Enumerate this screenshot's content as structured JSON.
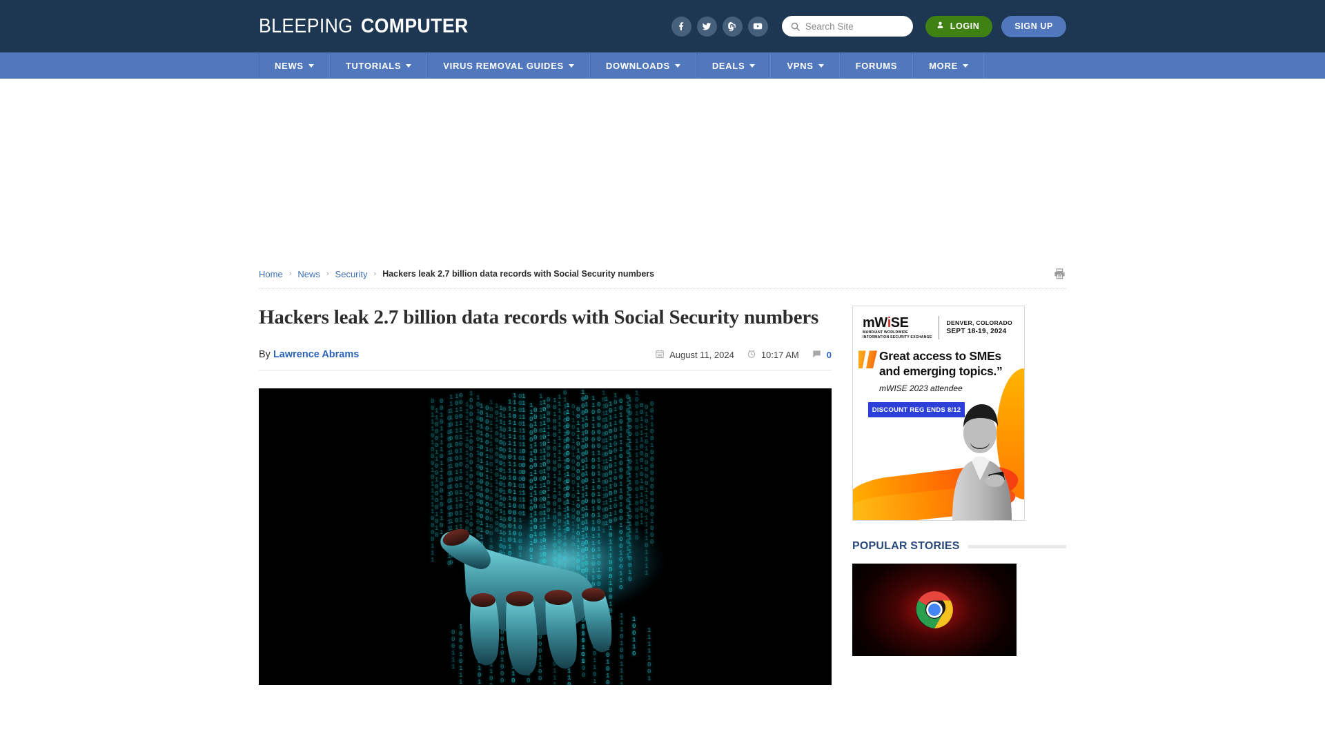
{
  "site": {
    "logo_thin": "BLEEPING",
    "logo_bold": "COMPUTER"
  },
  "header": {
    "social": [
      {
        "name": "facebook-icon",
        "label": "Facebook"
      },
      {
        "name": "twitter-icon",
        "label": "Twitter"
      },
      {
        "name": "mastodon-icon",
        "label": "Mastodon"
      },
      {
        "name": "youtube-icon",
        "label": "YouTube"
      }
    ],
    "search": {
      "placeholder": "Search Site",
      "value": ""
    },
    "login_label": "LOGIN",
    "signup_label": "SIGN UP",
    "colors": {
      "header_bg": "#1d3651",
      "nav_bg": "#5178bd",
      "login_green": "#3f8213",
      "signup_blue": "#5178bd"
    }
  },
  "nav": {
    "items": [
      {
        "label": "NEWS",
        "has_dropdown": true
      },
      {
        "label": "TUTORIALS",
        "has_dropdown": true
      },
      {
        "label": "VIRUS REMOVAL GUIDES",
        "has_dropdown": true
      },
      {
        "label": "DOWNLOADS",
        "has_dropdown": true
      },
      {
        "label": "DEALS",
        "has_dropdown": true
      },
      {
        "label": "VPNS",
        "has_dropdown": true
      },
      {
        "label": "FORUMS",
        "has_dropdown": false
      },
      {
        "label": "MORE",
        "has_dropdown": true
      }
    ]
  },
  "breadcrumb": {
    "home": "Home",
    "news": "News",
    "security": "Security",
    "current": "Hackers leak 2.7 billion data records with Social Security numbers",
    "separator": "›"
  },
  "article": {
    "headline": "Hackers leak 2.7 billion data records with Social Security numbers",
    "by_prefix": "By",
    "author": "Lawrence Abrams",
    "date": "August 11, 2024",
    "time": "10:17 AM",
    "comment_count": "0",
    "hero_alt": "Hand catching falling cyan binary digits on black background"
  },
  "sidebar": {
    "ad": {
      "brand_m": "m",
      "brand_w": "W",
      "brand_i": "i",
      "brand_se": "SE",
      "brand_sub1": "MANDIANT WORLDWIDE",
      "brand_sub2": "INFORMATION SECURITY EXCHANGE",
      "location": "DENVER, COLORADO",
      "dates": "SEPT 18-19, 2024",
      "quote_line1": "Great access to SMEs",
      "quote_line2": "and emerging topics.”",
      "attribution": "mWISE 2023 attendee",
      "cta_label": "DISCOUNT REG ENDS 8/12"
    },
    "popular": {
      "title": "POPULAR STORIES",
      "story_image_alt": "Google Chrome logo on black with red light burst"
    }
  }
}
